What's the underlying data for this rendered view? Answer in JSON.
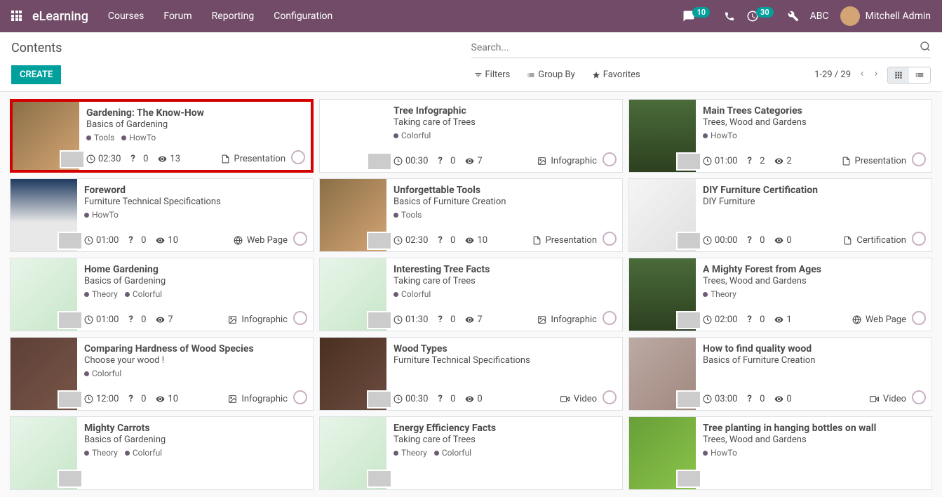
{
  "navbar": {
    "brand": "eLearning",
    "menu": [
      "Courses",
      "Forum",
      "Reporting",
      "Configuration"
    ],
    "chat_badge": "10",
    "activity_badge": "30",
    "company": "ABC",
    "user": "Mitchell Admin"
  },
  "control": {
    "breadcrumb": "Contents",
    "create": "CREATE",
    "search_placeholder": "Search...",
    "filters": "Filters",
    "groupby": "Group By",
    "favorites": "Favorites",
    "pager": "1-29 / 29"
  },
  "cards": [
    {
      "title": "Gardening: The Know-How",
      "subtitle": "Basics of Gardening",
      "tags": [
        "Tools",
        "HowTo"
      ],
      "duration": "02:30",
      "questions": "0",
      "views": "13",
      "type": "Presentation",
      "bg": "bg-garden",
      "highlighted": true
    },
    {
      "title": "Tree Infographic",
      "subtitle": "Taking care of Trees",
      "tags": [
        "Colorful"
      ],
      "duration": "00:30",
      "questions": "0",
      "views": "7",
      "type": "Infographic",
      "bg": "bg-tree"
    },
    {
      "title": "Main Trees Categories",
      "subtitle": "Trees, Wood and Gardens",
      "tags": [
        "HowTo"
      ],
      "duration": "01:00",
      "questions": "2",
      "views": "2",
      "type": "Presentation",
      "bg": "bg-forest"
    },
    {
      "title": "Foreword",
      "subtitle": "Furniture Technical Specifications",
      "tags": [
        "HowTo"
      ],
      "duration": "01:00",
      "questions": "0",
      "views": "10",
      "type": "Web Page",
      "bg": "bg-room"
    },
    {
      "title": "Unforgettable Tools",
      "subtitle": "Basics of Furniture Creation",
      "tags": [
        "Tools"
      ],
      "duration": "02:30",
      "questions": "0",
      "views": "10",
      "type": "Presentation",
      "bg": "bg-garden"
    },
    {
      "title": "DIY Furniture Certification",
      "subtitle": "DIY Furniture",
      "tags": [],
      "duration": "00:00",
      "questions": "0",
      "views": "0",
      "type": "Certification",
      "bg": "bg-furniture"
    },
    {
      "title": "Home Gardening",
      "subtitle": "Basics of Gardening",
      "tags": [
        "Theory",
        "Colorful"
      ],
      "duration": "01:00",
      "questions": "0",
      "views": "7",
      "type": "Infographic",
      "bg": "bg-chart"
    },
    {
      "title": "Interesting Tree Facts",
      "subtitle": "Taking care of Trees",
      "tags": [
        "Colorful"
      ],
      "duration": "01:30",
      "questions": "0",
      "views": "7",
      "type": "Infographic",
      "bg": "bg-chart"
    },
    {
      "title": "A Mighty Forest from Ages",
      "subtitle": "Trees, Wood and Gardens",
      "tags": [
        "Theory"
      ],
      "duration": "02:00",
      "questions": "0",
      "views": "1",
      "type": "Web Page",
      "bg": "bg-forest"
    },
    {
      "title": "Comparing Hardness of Wood Species",
      "subtitle": "Choose your wood !",
      "tags": [
        "Colorful"
      ],
      "duration": "12:00",
      "questions": "0",
      "views": "10",
      "type": "Infographic",
      "bg": "bg-wood"
    },
    {
      "title": "Wood Types",
      "subtitle": "Furniture Technical Specifications",
      "tags": [],
      "duration": "00:30",
      "questions": "0",
      "views": "0",
      "type": "Video",
      "bg": "bg-face"
    },
    {
      "title": "How to find quality wood",
      "subtitle": "Basics of Furniture Creation",
      "tags": [],
      "duration": "03:00",
      "questions": "0",
      "views": "0",
      "type": "Video",
      "bg": "bg-wood2"
    },
    {
      "title": "Mighty Carrots",
      "subtitle": "Basics of Gardening",
      "tags": [
        "Theory",
        "Colorful"
      ],
      "duration": "",
      "questions": "",
      "views": "",
      "type": "",
      "bg": "bg-chart",
      "nofooter": true
    },
    {
      "title": "Energy Efficiency Facts",
      "subtitle": "Taking care of Trees",
      "tags": [
        "Theory",
        "Colorful"
      ],
      "duration": "",
      "questions": "",
      "views": "",
      "type": "",
      "bg": "bg-chart",
      "nofooter": true
    },
    {
      "title": "Tree planting in hanging bottles on wall",
      "subtitle": "Trees, Wood and Gardens",
      "tags": [
        "HowTo"
      ],
      "duration": "",
      "questions": "",
      "views": "",
      "type": "",
      "bg": "bg-plant",
      "nofooter": true
    }
  ],
  "type_icons": {
    "Presentation": "▭",
    "Infographic": "▭",
    "Web Page": "▭",
    "Certification": "▭",
    "Video": "▭"
  }
}
